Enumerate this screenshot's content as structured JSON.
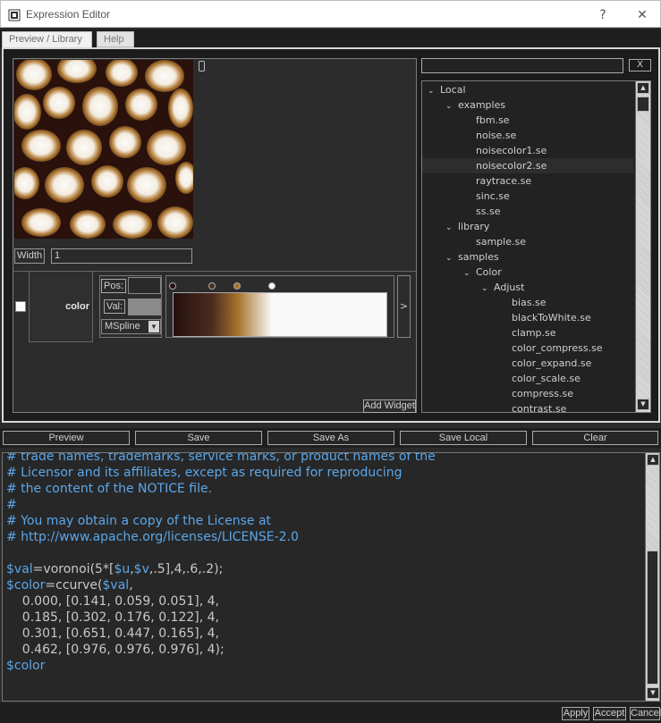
{
  "window": {
    "title": "Expression Editor",
    "help_glyph": "?",
    "close_glyph": "✕"
  },
  "tabs": [
    {
      "label": "Preview / Library",
      "active": true
    },
    {
      "label": "Help",
      "active": false
    }
  ],
  "preview": {
    "width_label": "Width",
    "width_value": "1"
  },
  "color_widget": {
    "label": "color",
    "checked": false,
    "pos_label": "Pos:",
    "val_label": "Val:",
    "interp_value": "MSpline",
    "expand_glyph": ">",
    "gradient_stops": [
      {
        "pos": 0.0,
        "color": "#240f0d"
      },
      {
        "pos": 0.185,
        "color": "#4d2d1f"
      },
      {
        "pos": 0.301,
        "color": "#a6722a"
      },
      {
        "pos": 0.462,
        "color": "#f9f9f9"
      }
    ]
  },
  "add_widget_label": "Add Widget",
  "library": {
    "filter_value": "",
    "clear_label": "X",
    "tree": [
      {
        "label": "Local",
        "depth": 0,
        "expanded": true
      },
      {
        "label": "examples",
        "depth": 1,
        "expanded": true
      },
      {
        "label": "fbm.se",
        "depth": 2
      },
      {
        "label": "noise.se",
        "depth": 2
      },
      {
        "label": "noisecolor1.se",
        "depth": 2
      },
      {
        "label": "noisecolor2.se",
        "depth": 2,
        "selected": true
      },
      {
        "label": "raytrace.se",
        "depth": 2
      },
      {
        "label": "sinc.se",
        "depth": 2
      },
      {
        "label": "ss.se",
        "depth": 2
      },
      {
        "label": "library",
        "depth": 1,
        "expanded": true
      },
      {
        "label": "sample.se",
        "depth": 2
      },
      {
        "label": "samples",
        "depth": 1,
        "expanded": true
      },
      {
        "label": "Color",
        "depth": 2,
        "expanded": true
      },
      {
        "label": "Adjust",
        "depth": 3,
        "expanded": true
      },
      {
        "label": "bias.se",
        "depth": 4
      },
      {
        "label": "blackToWhite.se",
        "depth": 4
      },
      {
        "label": "clamp.se",
        "depth": 4
      },
      {
        "label": "color_compress.se",
        "depth": 4
      },
      {
        "label": "color_expand.se",
        "depth": 4
      },
      {
        "label": "color_scale.se",
        "depth": 4
      },
      {
        "label": "compress.se",
        "depth": 4
      },
      {
        "label": "contrast.se",
        "depth": 4
      }
    ]
  },
  "toolbar": {
    "preview": "Preview",
    "save": "Save",
    "save_as": "Save As",
    "save_local": "Save Local",
    "clear": "Clear"
  },
  "editor": {
    "lines": [
      "# trade names, trademarks, service marks, or product names of the",
      "# Licensor and its affiliates, except as required for reproducing",
      "# the content of the NOTICE file.",
      "#",
      "# You may obtain a copy of the License at",
      "# http://www.apache.org/licenses/LICENSE-2.0",
      "",
      "$val=voronoi(5*[$u,$v,.5],4,.6,.2);",
      "$color=ccurve($val,",
      "    0.000, [0.141, 0.059, 0.051], 4,",
      "    0.185, [0.302, 0.176, 0.122], 4,",
      "    0.301, [0.651, 0.447, 0.165], 4,",
      "    0.462, [0.976, 0.976, 0.976], 4);",
      "$color"
    ]
  },
  "bottom": {
    "apply": "Apply",
    "accept": "Accept",
    "cancel": "Cancel"
  },
  "colors": {
    "comment": "#5aa7ea",
    "variable": "#5aa7ea",
    "text": "#c9c9c9"
  }
}
